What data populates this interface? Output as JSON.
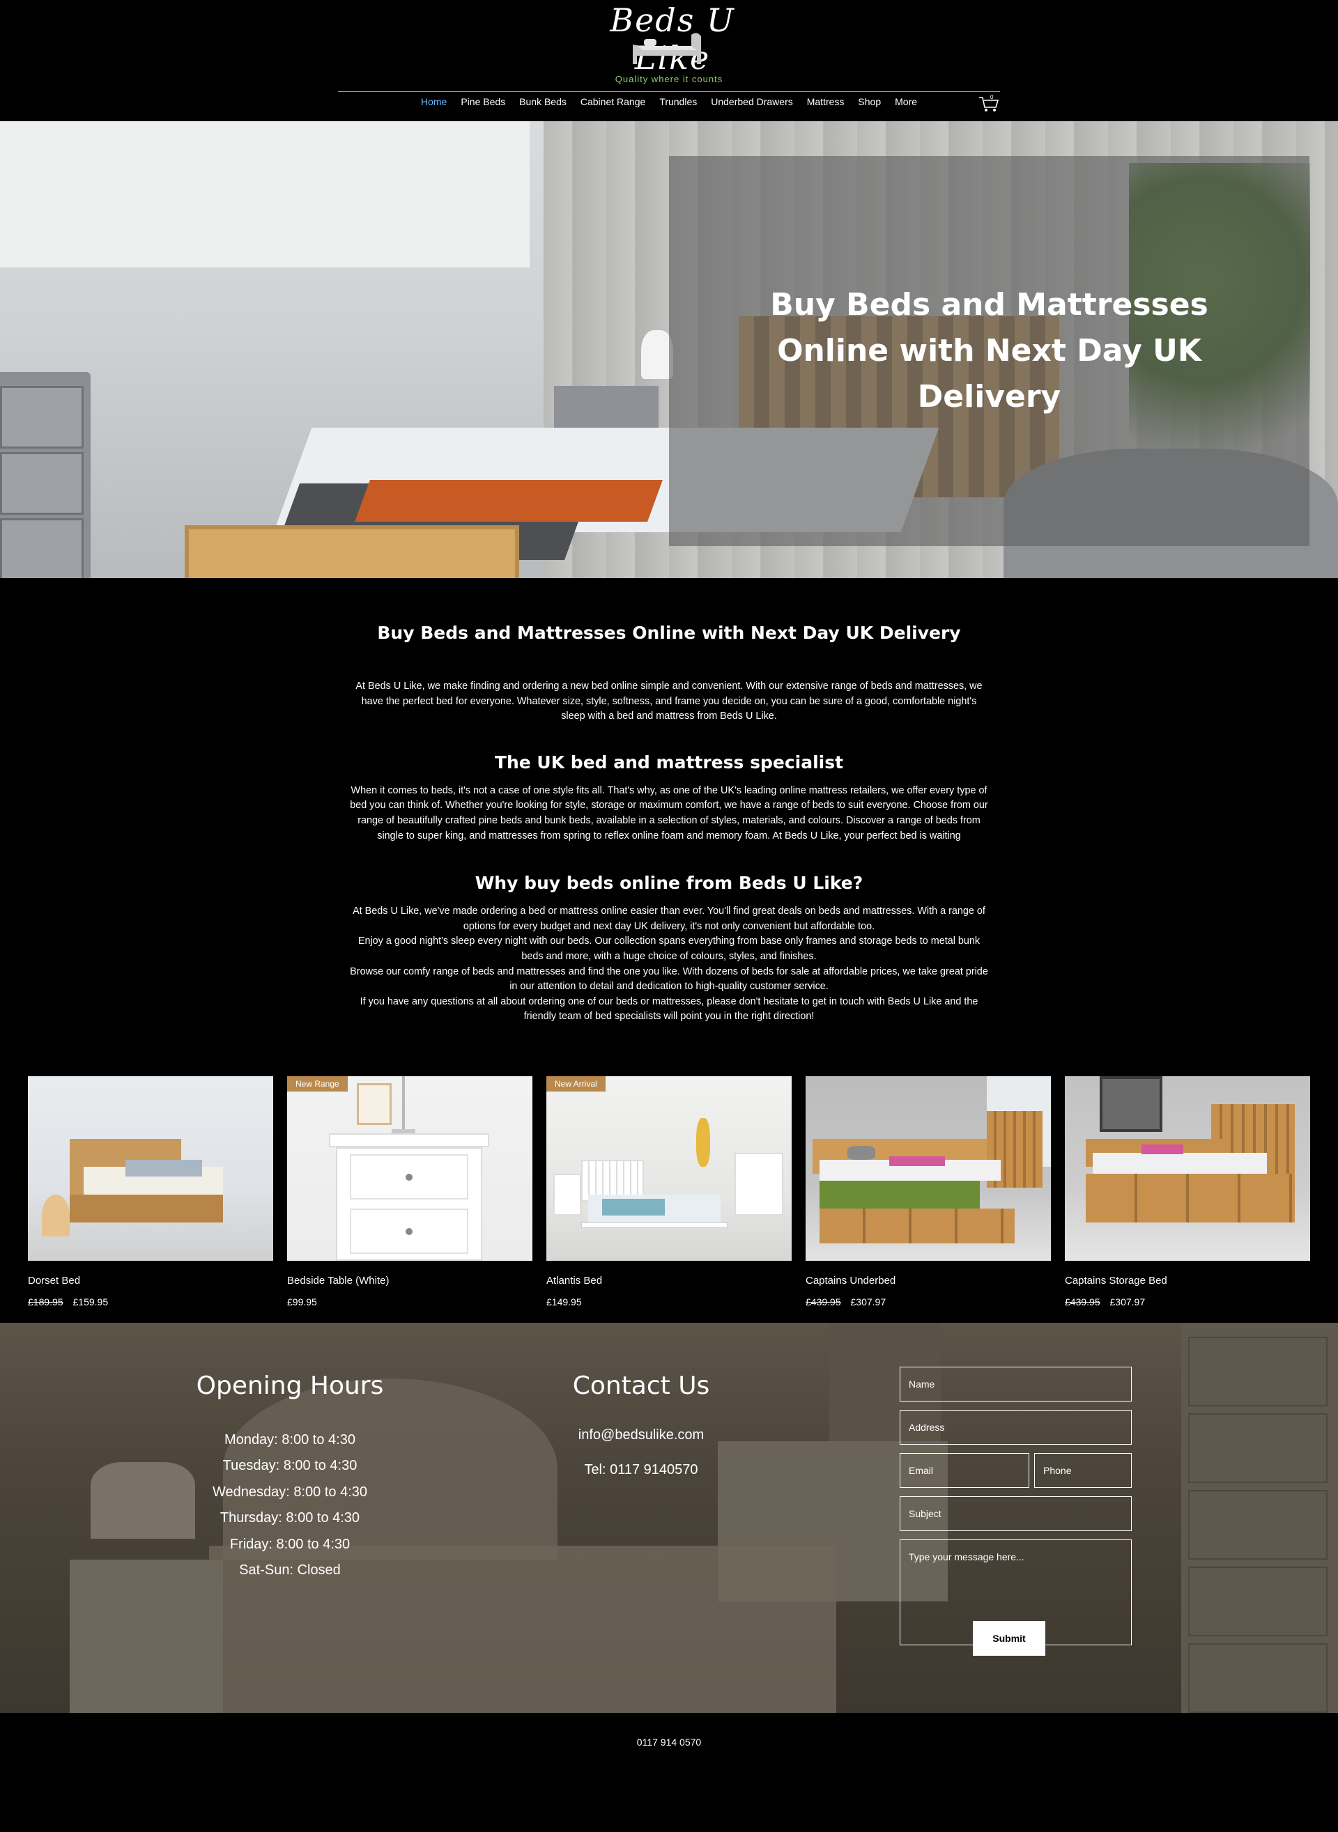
{
  "brand": {
    "logo_text": "Beds U Like",
    "tagline": "Quality where it counts",
    "accent": "#6bb6ff",
    "tagline_color": "#8fd06a"
  },
  "nav": {
    "items": [
      "Home",
      "Pine Beds",
      "Bunk Beds",
      "Cabinet Range",
      "Trundles",
      "Underbed Drawers",
      "Mattress",
      "Shop",
      "More"
    ],
    "active": "Home",
    "cart_count": "0",
    "cart_icon": "shopping-cart-icon"
  },
  "hero": {
    "title": "Buy Beds and Mattresses Online with Next Day UK Delivery"
  },
  "intro": {
    "heading1": "Buy Beds and Mattresses Online with Next Day UK Delivery",
    "para1": "At Beds U Like, we make finding and ordering a new bed online simple and convenient. With our extensive range of beds and mattresses, we have the perfect bed for everyone. Whatever size, style, softness, and frame you decide on, you can be sure of a good, comfortable night's sleep with a bed and mattress from Beds U Like.",
    "heading2": "The UK bed and mattress specialist",
    "para2": "When it comes to beds, it's not a case of one style fits all. That's why, as one of the UK's leading online mattress retailers, we offer every type of bed you can think of. Whether you're looking for style, storage or maximum comfort, we have a range of beds to suit everyone. Choose from our range of beautifully crafted pine beds and bunk beds, available in a selection of styles, materials, and colours. Discover a range of beds from single to super king, and mattresses from spring to reflex online foam and memory foam. At Beds U Like, your perfect bed is waiting",
    "heading3": "Why buy beds online from Beds U Like?",
    "para3a": "At Beds U Like, we've made ordering a bed or mattress online easier than ever. You'll find great deals on beds and mattresses. With a range of options for every budget and next day UK delivery, it's not only convenient but affordable too.",
    "para3b": "Enjoy a good night's sleep every night with our beds. Our collection spans everything from base only frames and storage beds to metal bunk beds and more, with a huge choice of colours, styles, and finishes.",
    "para3c": "Browse our comfy range of beds and mattresses and find the one you like. With dozens of beds for sale at affordable prices, we take great pride in our attention to detail and dedication to high-quality customer service.",
    "para3d": "If you have any questions at all about ordering one of our beds or mattresses, please don't hesitate to get in touch with Beds U Like and the friendly team of bed specialists will point you in the right direction!"
  },
  "products": [
    {
      "name": "Dorset Bed",
      "old_price": "£189.95",
      "price": "£159.95",
      "ribbon": ""
    },
    {
      "name": "Bedside Table (White)",
      "old_price": "",
      "price": "£99.95",
      "ribbon": "New Range"
    },
    {
      "name": "Atlantis Bed",
      "old_price": "",
      "price": "£149.95",
      "ribbon": "New Arrival"
    },
    {
      "name": "Captains Underbed",
      "old_price": "£439.95",
      "price": "£307.97",
      "ribbon": ""
    },
    {
      "name": "Captains Storage Bed",
      "old_price": "£439.95",
      "price": "£307.97",
      "ribbon": ""
    }
  ],
  "opening_hours": {
    "title": "Opening Hours",
    "lines": [
      "Monday: 8:00 to 4:30",
      "Tuesday: 8:00 to 4:30",
      "Wednesday: 8:00 to 4:30",
      "Thursday: 8:00 to 4:30",
      "Friday: 8:00 to 4:30",
      "Sat-Sun: Closed"
    ]
  },
  "contact": {
    "title": "Contact Us",
    "email": "info@bedsulike.com",
    "phone": "Tel: 0117 9140570"
  },
  "form": {
    "name_placeholder": "Name",
    "address_placeholder": "Address",
    "email_placeholder": "Email",
    "phone_placeholder": "Phone",
    "subject_placeholder": "Subject",
    "message_placeholder": "Type your message here...",
    "submit_label": "Submit"
  },
  "footer": {
    "phone": "0117 914 0570"
  }
}
